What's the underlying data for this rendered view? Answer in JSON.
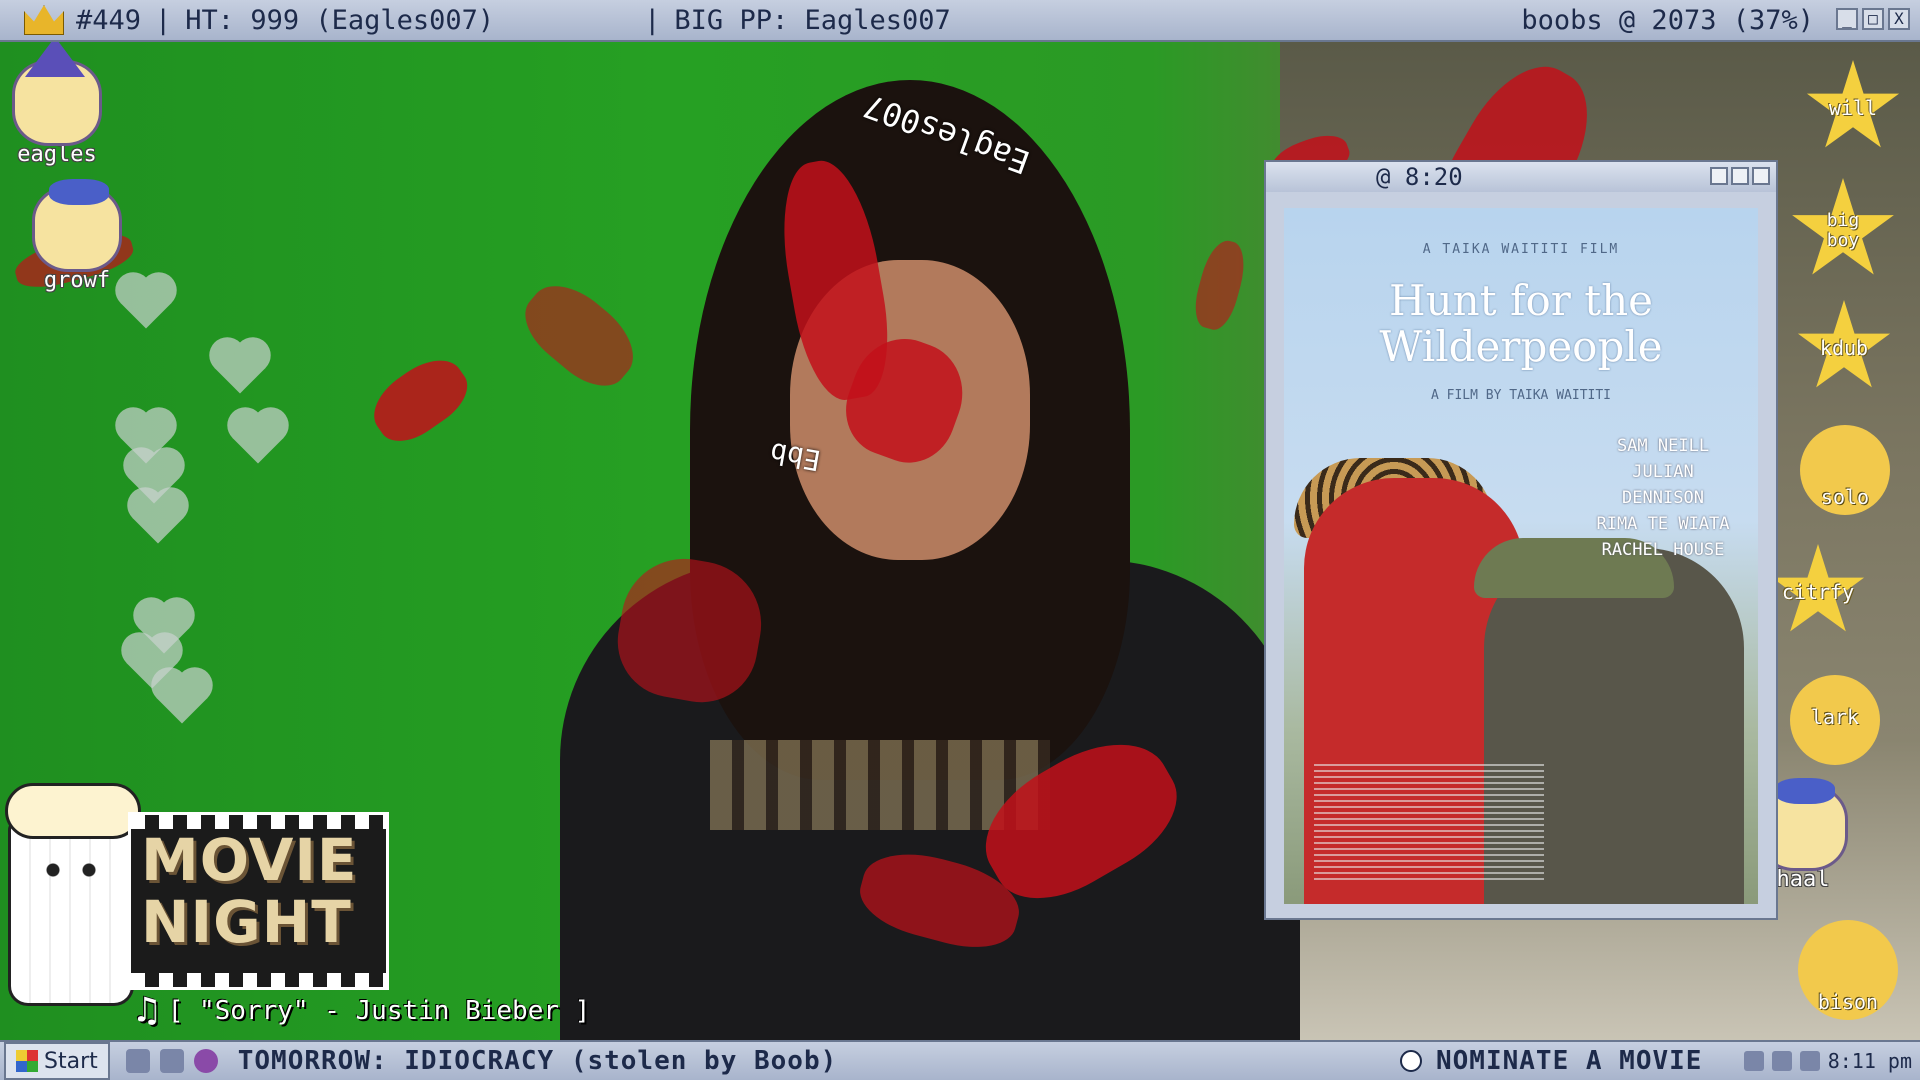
{
  "topbar": {
    "rank": "#449",
    "ht": "HT: 999 (Eagles007)",
    "big_pp": "BIG PP: Eagles007",
    "status": "boobs @ 2073 (37%)",
    "buttons": [
      "_",
      "□",
      "X"
    ]
  },
  "overlay": {
    "floating_username": "Eagles007",
    "face_text": "Ebb"
  },
  "left_avatars": [
    {
      "label": "eagles",
      "icon": "wizard-cat-icon"
    },
    {
      "label": "growf",
      "icon": "sleepy-cat-icon"
    }
  ],
  "right_badges": [
    {
      "label": "will",
      "shape": "star"
    },
    {
      "label": "big boy",
      "shape": "star"
    },
    {
      "label": "kdub",
      "shape": "star"
    },
    {
      "label": "solo",
      "shape": "moon"
    },
    {
      "label": "citrfy",
      "shape": "star"
    },
    {
      "label": "lark",
      "shape": "moon"
    },
    {
      "label": "haal",
      "shape": "cat"
    },
    {
      "label": "bison",
      "shape": "moon"
    }
  ],
  "poster_window": {
    "time": "@ 8:20",
    "poster_title_line1": "Hunt for the",
    "poster_title_line2": "Wilderpeople",
    "top_credits": "A TAIKA WAITITI FILM",
    "director_line": "A FILM BY TAIKA WAITITI",
    "cast": [
      "SAM NEILL",
      "JULIAN DENNISON",
      "RIMA TE WIATA",
      "RACHEL HOUSE"
    ]
  },
  "movie_night": {
    "line1": "MOVIE",
    "line2": "NIGHT",
    "now_playing": "[ \"Sorry\" - Justin Bieber ]"
  },
  "taskbar": {
    "start_label": "Start",
    "ticker": "TOMORROW: IDIOCRACY (stolen by Boob)",
    "nominate": "NOMINATE A MOVIE",
    "clock": "8:11 pm"
  }
}
